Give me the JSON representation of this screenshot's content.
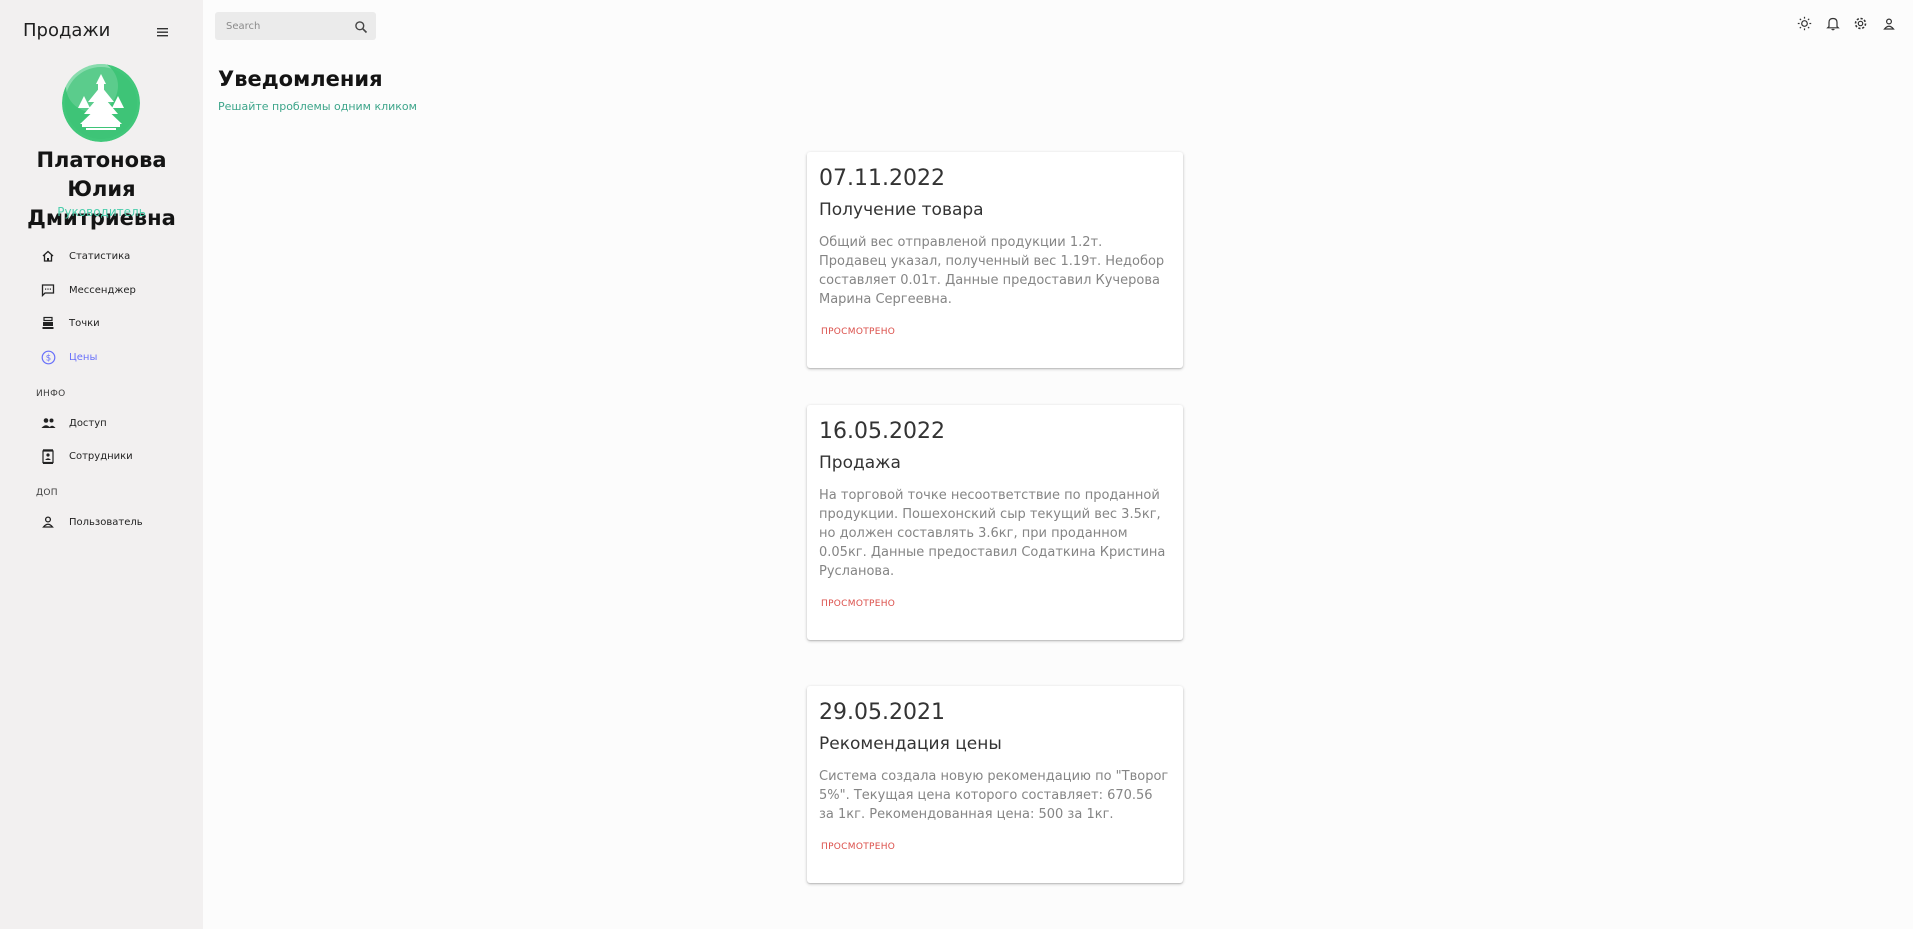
{
  "sidebar": {
    "brand": "Продажи",
    "profile_name": "Платонова Юлия Дмитриевна",
    "profile_role": "Руководитель",
    "items": [
      {
        "label": "Статистика"
      },
      {
        "label": "Мессенджер"
      },
      {
        "label": "Точки"
      },
      {
        "label": "Цены"
      },
      {
        "label": "Доступ"
      },
      {
        "label": "Сотрудники"
      },
      {
        "label": "Пользователь"
      }
    ],
    "sections": [
      "ИНФО",
      "ДОП"
    ]
  },
  "search": {
    "placeholder": "Search"
  },
  "page": {
    "title": "Уведомления",
    "subtitle": "Решайте проблемы одним кликом"
  },
  "notifications": [
    {
      "date": "07.11.2022",
      "title": "Получение товара",
      "text": "Общий вес отправленой продукции 1.2т. Продавец указал, полученный вес 1.19т. Недобор составляет 0.01т. Данные предоставил Кучерова Марина Сергеевна.",
      "action": "ПРОСМОТРЕНО"
    },
    {
      "date": "16.05.2022",
      "title": "Продажа",
      "text": "На торговой точке несоответствие по проданной продукции. Пошехонский сыр текущий вес 3.5кг, но должен составлять 3.6кг, при проданном 0.05кг. Данные предоставил Содаткина Кристина Русланова.",
      "action": "ПРОСМОТРЕНО"
    },
    {
      "date": "29.05.2021",
      "title": "Рекомендация цены",
      "text": "Система создала новую рекомендацию по \"Творог 5%\". Текущая цена которого составляет: 670.56 за 1кг. Рекомендованная цена: 500 за 1кг.",
      "action": "ПРОСМОТРЕНО"
    }
  ],
  "colors": {
    "accent_green": "#4cceac",
    "active_item": "#6870fa",
    "action_red": "#db4f4a"
  }
}
